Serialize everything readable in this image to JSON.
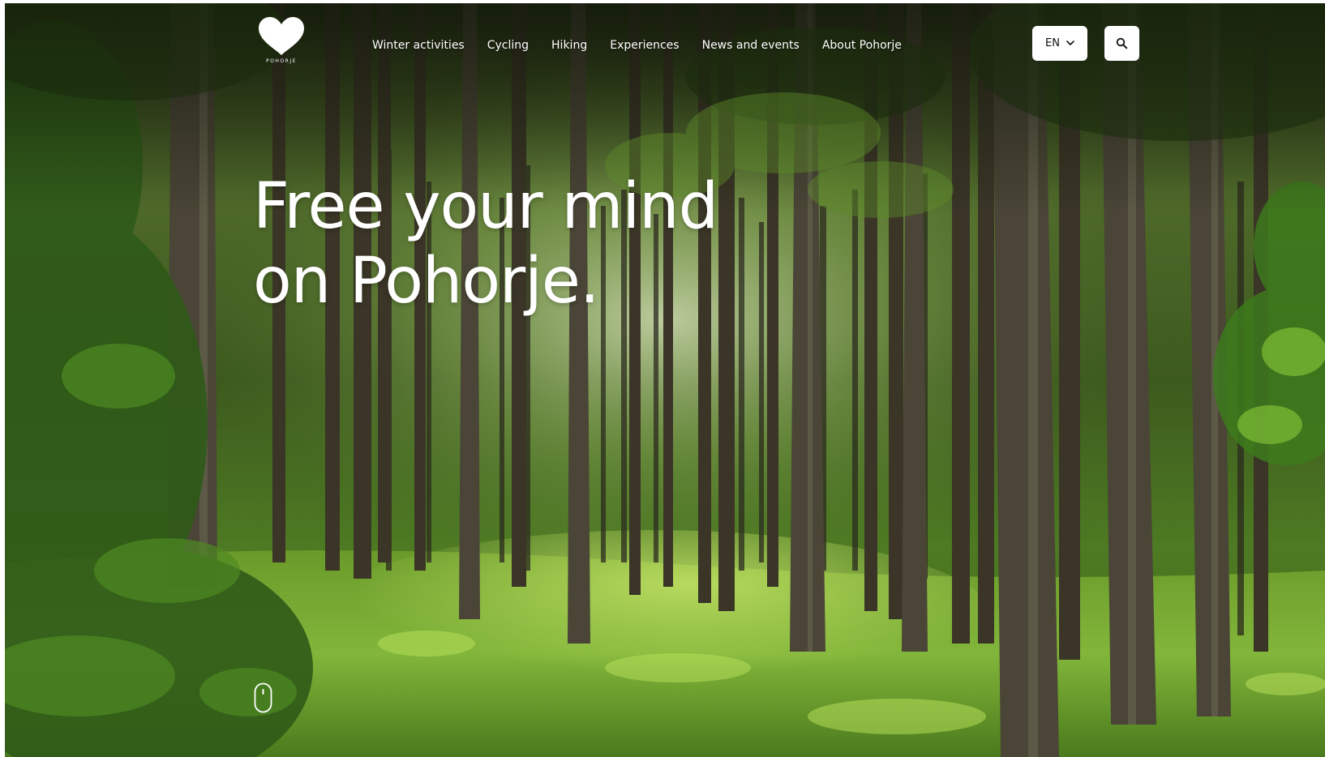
{
  "logo": {
    "text": "POHORJE"
  },
  "nav": {
    "items": [
      {
        "label": "Winter activities"
      },
      {
        "label": "Cycling"
      },
      {
        "label": "Hiking"
      },
      {
        "label": "Experiences"
      },
      {
        "label": "News and events"
      },
      {
        "label": "About Pohorje"
      }
    ]
  },
  "header": {
    "language": "EN",
    "language_icon": "chevron-down-icon",
    "search_icon": "search-icon"
  },
  "hero": {
    "headline_line1": "Free your mind",
    "headline_line2": "on Pohorje.",
    "scroll_icon": "mouse-scroll-icon"
  },
  "colors": {
    "text": "#ffffff",
    "button_bg": "#ffffff",
    "forest_dark": "#1e2a10",
    "forest_light": "#8fc43a"
  }
}
